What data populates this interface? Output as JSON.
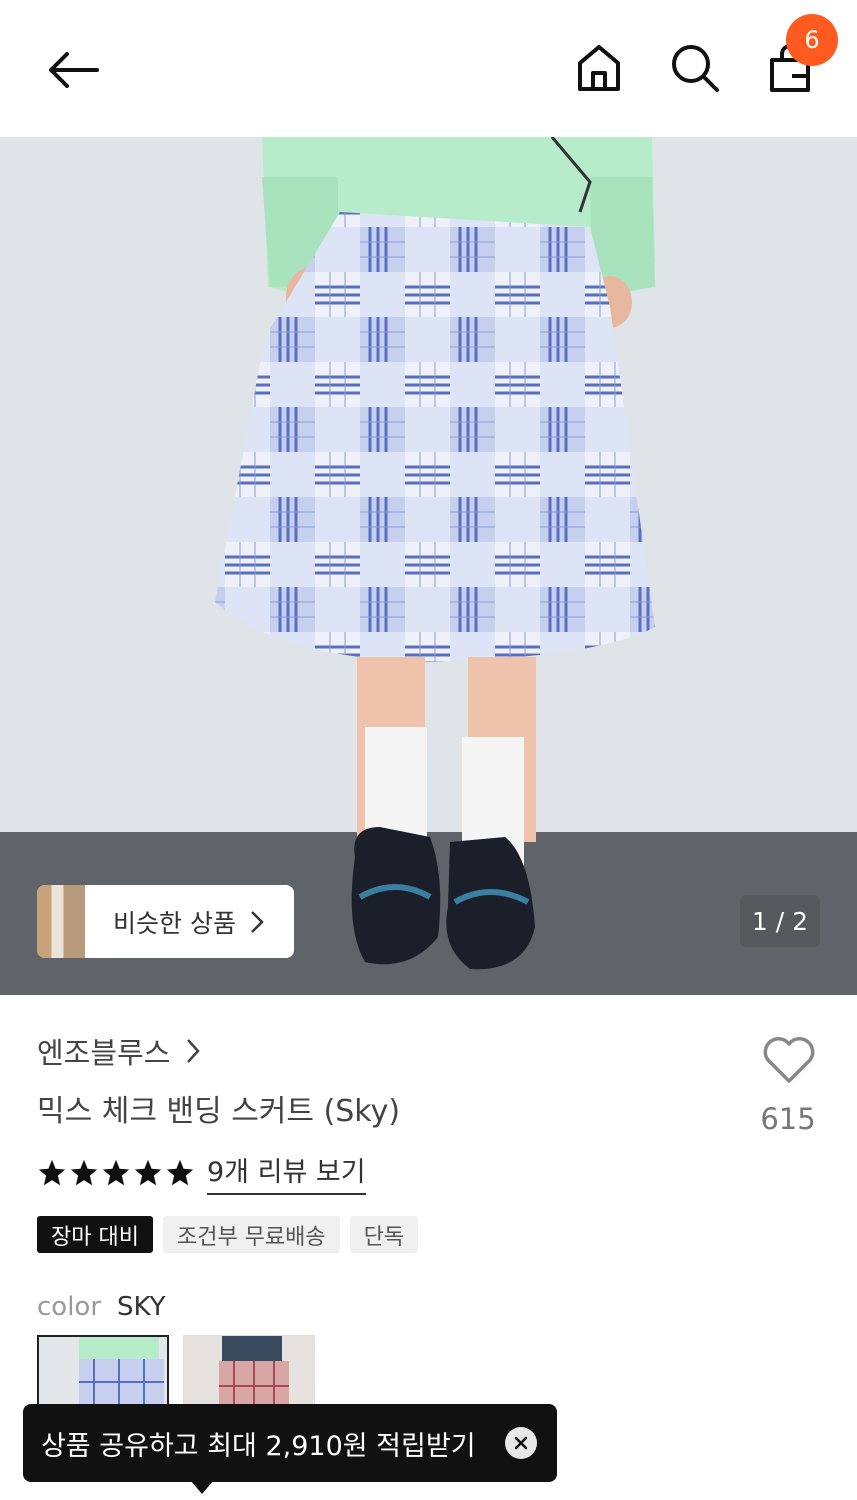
{
  "header": {
    "cart_count": "6",
    "icons": [
      "back-arrow-icon",
      "home-icon",
      "search-icon",
      "shopping-bag-icon"
    ]
  },
  "hero": {
    "similar_label": "비슷한 상품",
    "pager": "1 / 2"
  },
  "product": {
    "brand": "엔조블루스",
    "title": "믹스 체크 밴딩 스커트 (Sky)",
    "like_count": "615",
    "rating_stars": 5,
    "review_link": "9개 리뷰 보기",
    "tags": [
      "장마 대비",
      "조건부 무료배송",
      "단독"
    ],
    "color_label": "color",
    "color_value": "SKY"
  },
  "toast": {
    "text": "상품 공유하고 최대 2,910원 적립받기"
  },
  "colors": {
    "accent": "#ff5a1f",
    "toast_bg": "#111111"
  }
}
